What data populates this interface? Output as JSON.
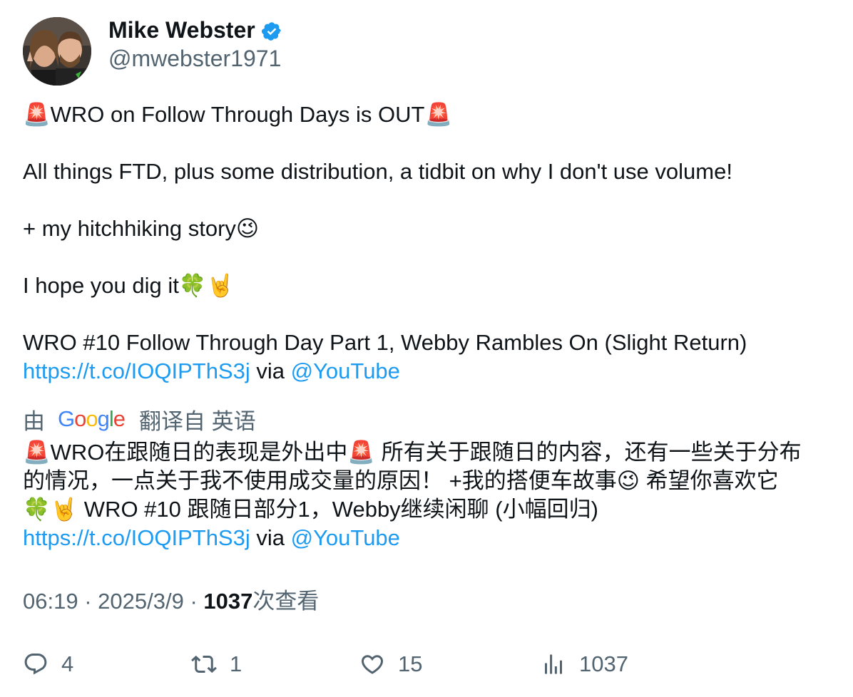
{
  "author": {
    "name": "Mike Webster",
    "handle": "@mwebster1971"
  },
  "tweet": {
    "line1_pre": "🚨",
    "line1_text": "WRO on Follow Through Days is OUT",
    "line1_post": "🚨",
    "line2": "All things FTD, plus some distribution, a tidbit on why I don't use volume!",
    "line3_text": "+ my hitchhiking story",
    "line3_emoji": "😉",
    "line4_text": "I hope you dig it",
    "line4_emoji": "🍀🤘",
    "line5": "WRO #10 Follow Through Day Part 1, Webby Rambles On (Slight Return)",
    "link": "https://t.co/IOQIPThS3j",
    "via": "via",
    "mention": "@YouTube"
  },
  "translation": {
    "prefix": "由",
    "provider": "Google",
    "suffix": "翻译自 英语",
    "line1": "🚨WRO在跟随日的表现是外出中🚨 所有关于跟随日的内容，还有一些关于分布",
    "line2": "的情况，一点关于我不使用成交量的原因！ +我的搭便车故事😉 希望你喜欢它",
    "line3": "🍀🤘 WRO #10 跟随日部分1，Webby继续闲聊 (小幅回归)",
    "link": "https://t.co/IOQIPThS3j",
    "via": "via",
    "mention": "@YouTube"
  },
  "meta": {
    "time": "06:19",
    "date": "2025/3/9",
    "views_count": "1037",
    "views_label": "次查看"
  },
  "actions": {
    "replies": "4",
    "retweets": "1",
    "likes": "15",
    "views": "1037"
  },
  "colors": {
    "link": "#1d9bf0",
    "secondary": "#536471",
    "verified": "#1d9bf0"
  }
}
